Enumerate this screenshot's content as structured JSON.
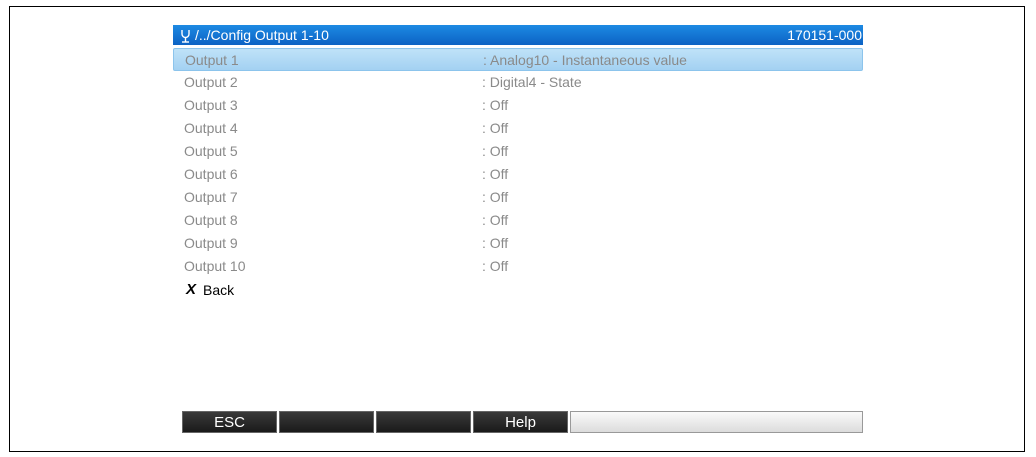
{
  "header": {
    "path": "/../Config Output 1-10",
    "code": "170151-000",
    "icon": "setup-icon"
  },
  "rows": [
    {
      "label": "Output 1",
      "value": ": Analog10 - Instantaneous value"
    },
    {
      "label": "Output 2",
      "value": ": Digital4 - State"
    },
    {
      "label": "Output 3",
      "value": ": Off"
    },
    {
      "label": "Output 4",
      "value": ": Off"
    },
    {
      "label": "Output 5",
      "value": ": Off"
    },
    {
      "label": "Output 6",
      "value": ": Off"
    },
    {
      "label": "Output 7",
      "value": ": Off"
    },
    {
      "label": "Output 8",
      "value": ": Off"
    },
    {
      "label": "Output 9",
      "value": ": Off"
    },
    {
      "label": "Output 10",
      "value": ": Off"
    }
  ],
  "back": {
    "icon": "X",
    "label": "Back"
  },
  "softkeys": [
    "ESC",
    "",
    "",
    "Help",
    ""
  ],
  "colors": {
    "title_bg": "#0c62c4",
    "selected_bg": "#bfe2f8",
    "row_text": "#8a8a8a"
  }
}
